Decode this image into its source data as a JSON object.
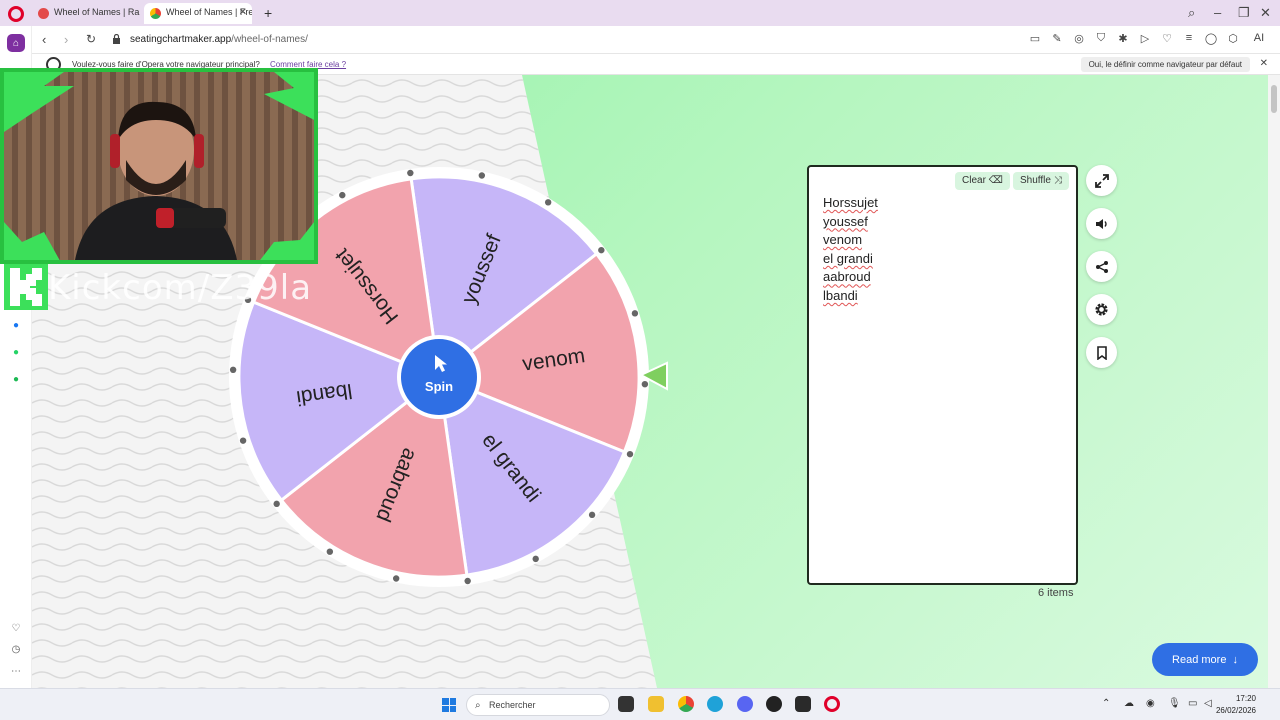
{
  "browser": {
    "tabs": [
      {
        "label": "Wheel of Names | Random",
        "active": false
      },
      {
        "label": "Wheel of Names | Free Ra",
        "active": true
      }
    ],
    "url_host": "seatingchartmaker.app",
    "url_path": "/wheel-of-names/",
    "infobar_message": "Voulez-vous faire d'Opera votre navigateur principal?",
    "infobar_link": "Comment faire cela ?",
    "infobar_button": "Oui, le définir comme navigateur par défaut",
    "ai_label": "AI"
  },
  "wheel": {
    "spin_label": "Spin",
    "segments": [
      {
        "name": "youssef",
        "color": "#c6b6f8"
      },
      {
        "name": "venom",
        "color": "#f2a3ad"
      },
      {
        "name": "el grandi",
        "color": "#c6b6f8"
      },
      {
        "name": "aabroud",
        "color": "#f2a3ad"
      },
      {
        "name": "lbandi",
        "color": "#c6b6f8"
      },
      {
        "name": "Horssujet",
        "color": "#f2a3ad"
      }
    ],
    "pointer_color": "#7fcf5f",
    "hub_color": "#2f6fe4"
  },
  "entries_panel": {
    "clear_label": "Clear",
    "shuffle_label": "Shuffle",
    "entries": [
      "Horssujet",
      "youssef",
      "venom",
      "el grandi",
      "aabroud",
      "lbandi"
    ],
    "count_label": "6 items"
  },
  "side_actions": [
    "expand-icon",
    "volume-icon",
    "share-icon",
    "settings-icon",
    "bookmark-icon"
  ],
  "read_more_label": "Read more",
  "webcam_overlay_text": "Kickcom/Z39la",
  "taskbar": {
    "search_placeholder": "Rechercher",
    "time": "17:20",
    "date": "26/02/2026"
  },
  "colors": {
    "accent_blue": "#2f6fe4",
    "opera_red": "#e0002a",
    "page_green": "#93f2a6"
  }
}
